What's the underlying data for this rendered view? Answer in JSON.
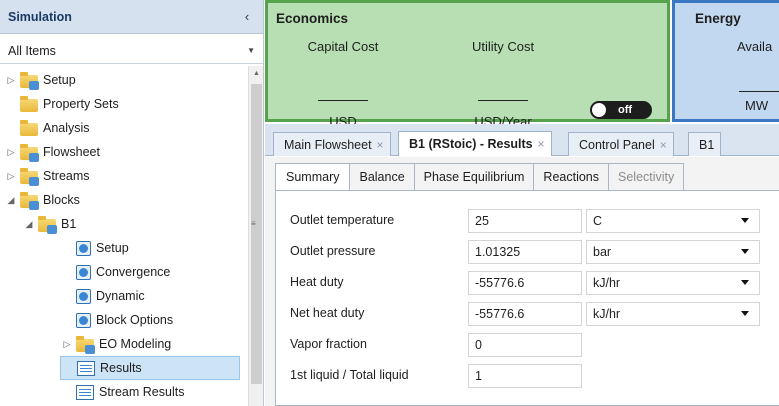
{
  "nav": {
    "title": "Simulation",
    "collapse_icon": "‹",
    "filter": "All Items",
    "tree": [
      {
        "label": "Setup",
        "icon": "folder-blue",
        "expander": "▷",
        "indent": 0
      },
      {
        "label": "Property Sets",
        "icon": "folder",
        "expander": "",
        "indent": 0
      },
      {
        "label": "Analysis",
        "icon": "folder",
        "expander": "",
        "indent": 0
      },
      {
        "label": "Flowsheet",
        "icon": "folder-blue",
        "expander": "▷",
        "indent": 0
      },
      {
        "label": "Streams",
        "icon": "folder-blue",
        "expander": "▷",
        "indent": 0
      },
      {
        "label": "Blocks",
        "icon": "folder-blue",
        "expander": "◢",
        "indent": 0
      },
      {
        "label": "B1",
        "icon": "folder-blue",
        "expander": "◢",
        "indent": 1
      },
      {
        "label": "Setup",
        "icon": "check",
        "expander": "",
        "indent": 2
      },
      {
        "label": "Convergence",
        "icon": "check",
        "expander": "",
        "indent": 2
      },
      {
        "label": "Dynamic",
        "icon": "check",
        "expander": "",
        "indent": 2
      },
      {
        "label": "Block Options",
        "icon": "check",
        "expander": "",
        "indent": 2
      },
      {
        "label": "EO Modeling",
        "icon": "folder-blue",
        "expander": "▷",
        "indent": 2
      },
      {
        "label": "Results",
        "icon": "results",
        "expander": "",
        "indent": 2,
        "selected": true
      },
      {
        "label": "Stream Results",
        "icon": "results",
        "expander": "",
        "indent": 2
      }
    ]
  },
  "economics": {
    "title": "Economics",
    "capital_cost_label": "Capital Cost",
    "utility_cost_label": "Utility Cost",
    "capital_cost_unit": "USD",
    "utility_cost_unit": "USD/Year",
    "toggle_label": "off"
  },
  "energy": {
    "title": "Energy",
    "available_label": "Availa",
    "unit": "MW"
  },
  "doc_tabs": [
    {
      "label": "Main Flowsheet",
      "active": false
    },
    {
      "label": "B1 (RStoic) - Results",
      "active": true
    },
    {
      "label": "Control Panel",
      "active": false
    },
    {
      "label": "B1",
      "active": false
    }
  ],
  "inner_tabs": [
    {
      "label": "Summary",
      "active": true
    },
    {
      "label": "Balance"
    },
    {
      "label": "Phase Equilibrium"
    },
    {
      "label": "Reactions"
    },
    {
      "label": "Selectivity",
      "disabled": true
    }
  ],
  "results": [
    {
      "label": "Outlet temperature",
      "value": "25",
      "unit": "C"
    },
    {
      "label": "Outlet pressure",
      "value": "1.01325",
      "unit": "bar"
    },
    {
      "label": "Heat duty",
      "value": "-55776.6",
      "unit": "kJ/hr"
    },
    {
      "label": "Net heat duty",
      "value": "-55776.6",
      "unit": "kJ/hr"
    },
    {
      "label": "Vapor fraction",
      "value": "0"
    },
    {
      "label": "1st liquid / Total liquid",
      "value": "1"
    }
  ],
  "colors": {
    "economics_bg": "#b7dfb3",
    "economics_border": "#56a24d",
    "energy_bg": "#c2d8f0",
    "energy_border": "#3a78c3"
  }
}
